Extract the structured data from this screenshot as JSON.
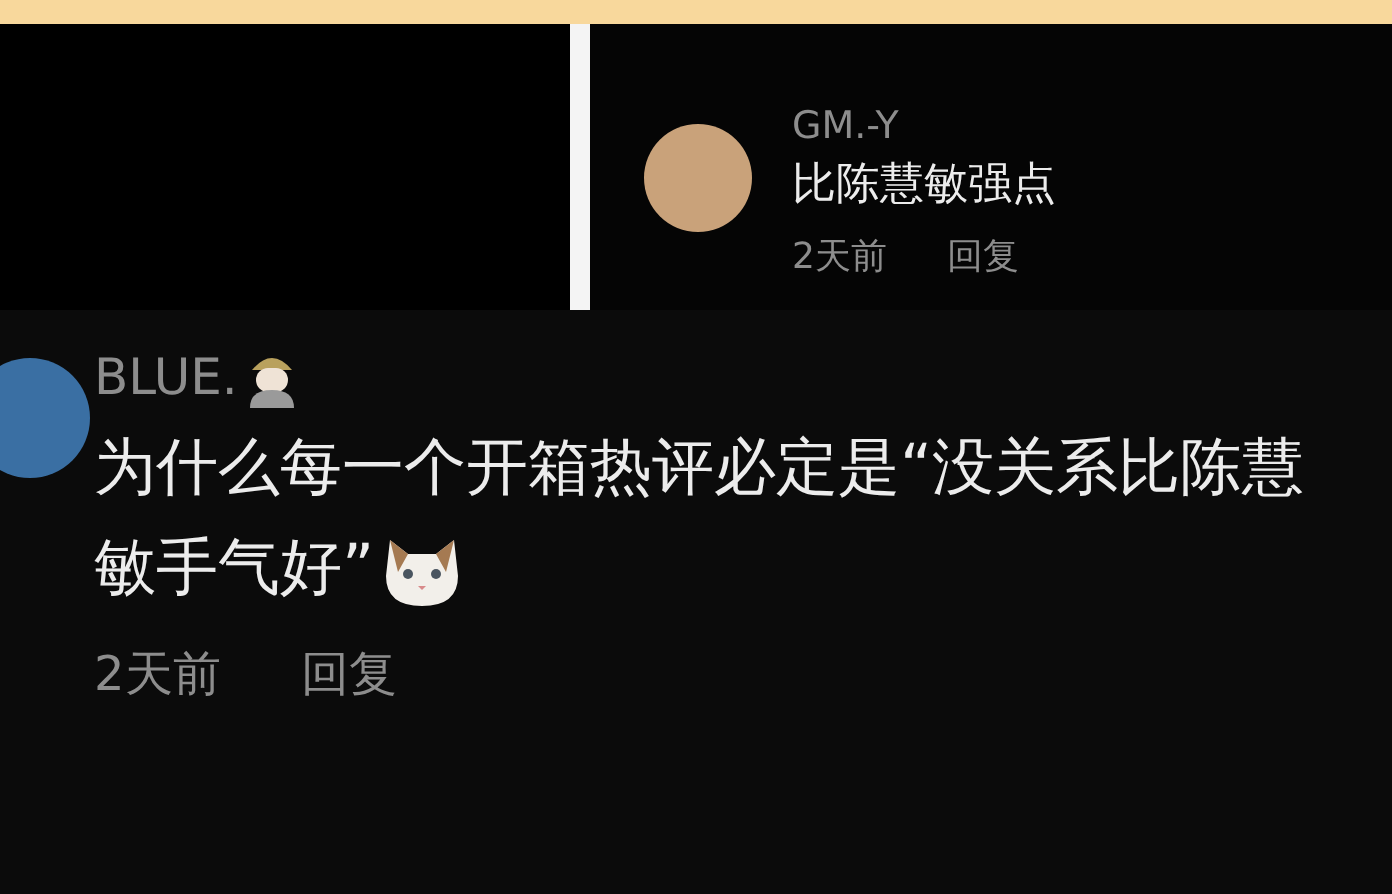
{
  "reply": {
    "username": "GM.-Y",
    "text": "比陈慧敏强点",
    "time": "2天前",
    "reply_button": "回复"
  },
  "comment": {
    "username": "BLUE.",
    "text": "为什么每一个开箱热评必定是“没关系比陈慧敏手气好”",
    "time": "2天前",
    "reply_button": "回复"
  }
}
